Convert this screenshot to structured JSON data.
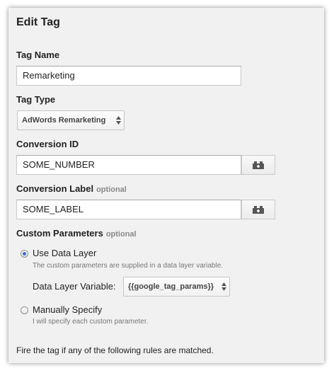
{
  "dialog": {
    "title": "Edit Tag"
  },
  "tag_name": {
    "label": "Tag Name",
    "value": "Remarketing"
  },
  "tag_type": {
    "label": "Tag Type",
    "selected": "AdWords Remarketing"
  },
  "conversion_id": {
    "label": "Conversion ID",
    "value": "SOME_NUMBER",
    "macro_icon": "macro-brick-icon"
  },
  "conversion_label": {
    "label": "Conversion Label",
    "optional": "optional",
    "value": "SOME_LABEL",
    "macro_icon": "macro-brick-icon"
  },
  "custom_parameters": {
    "label": "Custom Parameters",
    "optional": "optional",
    "options": [
      {
        "label": "Use Data Layer",
        "help": "The custom parameters are supplied in a data layer variable.",
        "selected": true
      },
      {
        "label": "Manually Specify",
        "help": "I will specify each custom parameter.",
        "selected": false
      }
    ],
    "data_layer_variable": {
      "label": "Data Layer Variable:",
      "selected": "{{google_tag_params}}"
    }
  },
  "rules": {
    "text": "Fire the tag if any of the following rules are matched."
  }
}
